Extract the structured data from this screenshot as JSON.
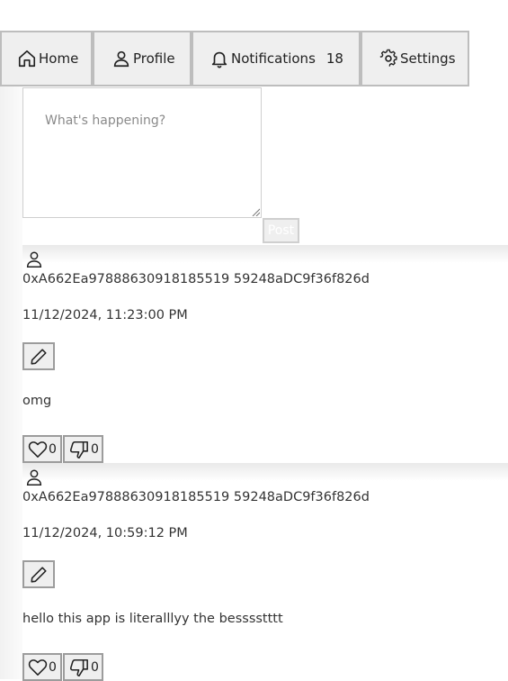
{
  "nav": {
    "items": [
      {
        "label": "Home",
        "icon": "home-icon"
      },
      {
        "label": "Profile",
        "icon": "user-icon"
      },
      {
        "label": "Notifications",
        "icon": "bell-icon",
        "count": "18"
      },
      {
        "label": "Settings",
        "icon": "gear-icon"
      }
    ]
  },
  "composer": {
    "placeholder": "What's happening?",
    "post_label": "Post"
  },
  "posts": [
    {
      "author": "0xA662Ea97888630918185519 59248aDC9f36f826d",
      "timestamp": "11/12/2024, 11:23:00 PM",
      "content": "omg",
      "likes": "0",
      "dislikes": "0"
    },
    {
      "author": "0xA662Ea97888630918185519 59248aDC9f36f826d",
      "timestamp": "11/12/2024, 10:59:12 PM",
      "content": "hello this app is literalllyy the besssstttt",
      "likes": "0",
      "dislikes": "0"
    }
  ]
}
